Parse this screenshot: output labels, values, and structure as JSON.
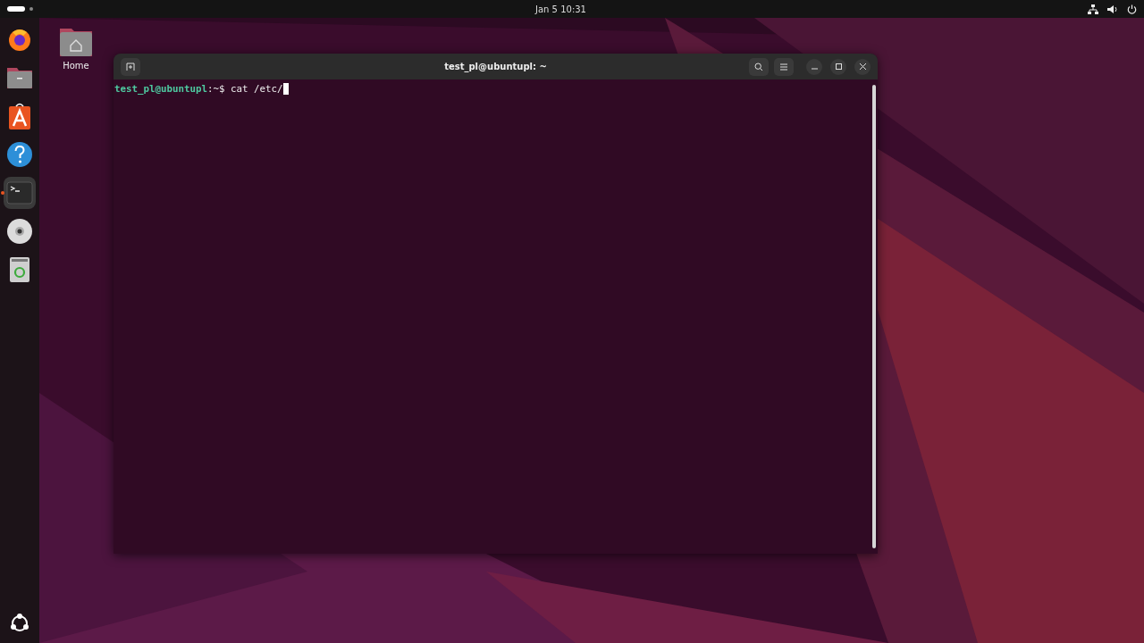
{
  "top_bar": {
    "clock": "Jan 5  10:31"
  },
  "dock": {
    "apps": [
      {
        "kind": "browser",
        "running": false
      },
      {
        "kind": "files",
        "running": false
      },
      {
        "kind": "store",
        "running": false
      },
      {
        "kind": "help",
        "running": false
      },
      {
        "kind": "terminal",
        "running": true
      },
      {
        "kind": "disc",
        "running": false
      },
      {
        "kind": "trash",
        "running": false
      }
    ]
  },
  "desktop_icons": [
    {
      "label": "Home"
    }
  ],
  "terminal": {
    "title": "test_pl@ubuntupl: ~",
    "lines": [
      "**test_pl@ubuntupl**:~$ cat /etc/"
    ]
  }
}
